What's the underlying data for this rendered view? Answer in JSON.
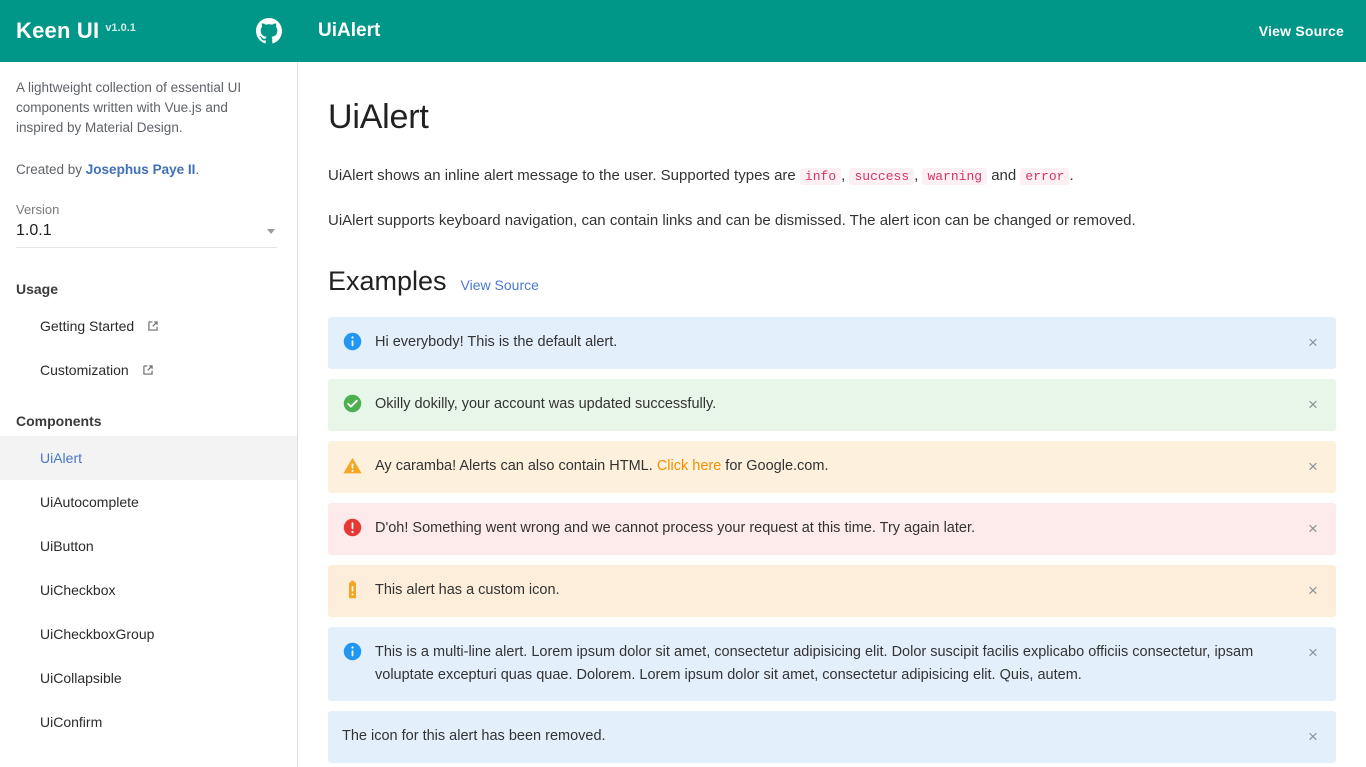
{
  "header": {
    "brand_title": "Keen UI",
    "brand_version": "v1.0.1",
    "github_icon": "github-icon",
    "page_title": "UiAlert",
    "view_source_label": "View Source"
  },
  "sidebar": {
    "description": "A lightweight collection of essential UI components written with Vue.js and inspired by Material Design.",
    "credit_prefix": "Created by ",
    "credit_link": "Josephus Paye II",
    "credit_suffix": ".",
    "version_label": "Version",
    "version_value": "1.0.1",
    "caret_icon": "chevron-down-icon",
    "usage_title": "Usage",
    "usage_items": [
      {
        "label": "Getting Started",
        "icon": "external-link-icon"
      },
      {
        "label": "Customization",
        "icon": "external-link-icon"
      }
    ],
    "components_title": "Components",
    "components": [
      {
        "label": "UiAlert",
        "active": true
      },
      {
        "label": "UiAutocomplete",
        "active": false
      },
      {
        "label": "UiButton",
        "active": false
      },
      {
        "label": "UiCheckbox",
        "active": false
      },
      {
        "label": "UiCheckboxGroup",
        "active": false
      },
      {
        "label": "UiCollapsible",
        "active": false
      },
      {
        "label": "UiConfirm",
        "active": false
      }
    ]
  },
  "main": {
    "title": "UiAlert",
    "intro_1": {
      "part_1": "UiAlert shows an inline alert message to the user. Supported types are ",
      "code_1": "info",
      "sep_1": ", ",
      "code_2": "success",
      "sep_2": ", ",
      "code_3": "warning",
      "sep_3": " and ",
      "code_4": "error",
      "part_end": "."
    },
    "intro_2": "UiAlert supports keyboard navigation, can contain links and can be dismissed. The alert icon can be changed or removed.",
    "examples_title": "Examples",
    "examples_view_source": "View Source",
    "close_glyph": "×",
    "alerts": [
      {
        "type": "info",
        "icon": "info-circle-icon",
        "text": "Hi everybody! This is the default alert."
      },
      {
        "type": "success",
        "icon": "check-circle-icon",
        "text": "Okilly dokilly, your account was updated successfully."
      },
      {
        "type": "warning",
        "icon": "warning-triangle-icon",
        "text_before_link": "Ay caramba! Alerts can also contain HTML. ",
        "link_text": "Click here",
        "text_after_link": " for Google.com."
      },
      {
        "type": "error",
        "icon": "error-circle-icon",
        "text": "D'oh! Something went wrong and we cannot process your request at this time. Try again later."
      },
      {
        "type": "custom",
        "icon": "battery-alert-icon",
        "text": "This alert has a custom icon."
      },
      {
        "type": "info",
        "icon": "info-circle-icon",
        "text": "This is a multi-line alert. Lorem ipsum dolor sit amet, consectetur adipisicing elit. Dolor suscipit facilis explicabo officiis consectetur, ipsam voluptate excepturi quas quae. Dolorem. Lorem ipsum dolor sit amet, consectetur adipisicing elit. Quis, autem."
      },
      {
        "type": "info",
        "icon": "none",
        "text": "The icon for this alert has been removed."
      }
    ]
  },
  "colors": {
    "brand_teal": "#009688",
    "info_bg": "#e3f0fc",
    "success_bg": "#e8f5e9",
    "warning_bg": "#fdf0dd",
    "error_bg": "#fdeaea",
    "info_icon": "#2196f3",
    "success_icon": "#4caf50",
    "warning_icon": "#f5a623",
    "error_icon": "#e53935",
    "link_blue": "#4a79cf",
    "code_pink": "#d6336c"
  }
}
